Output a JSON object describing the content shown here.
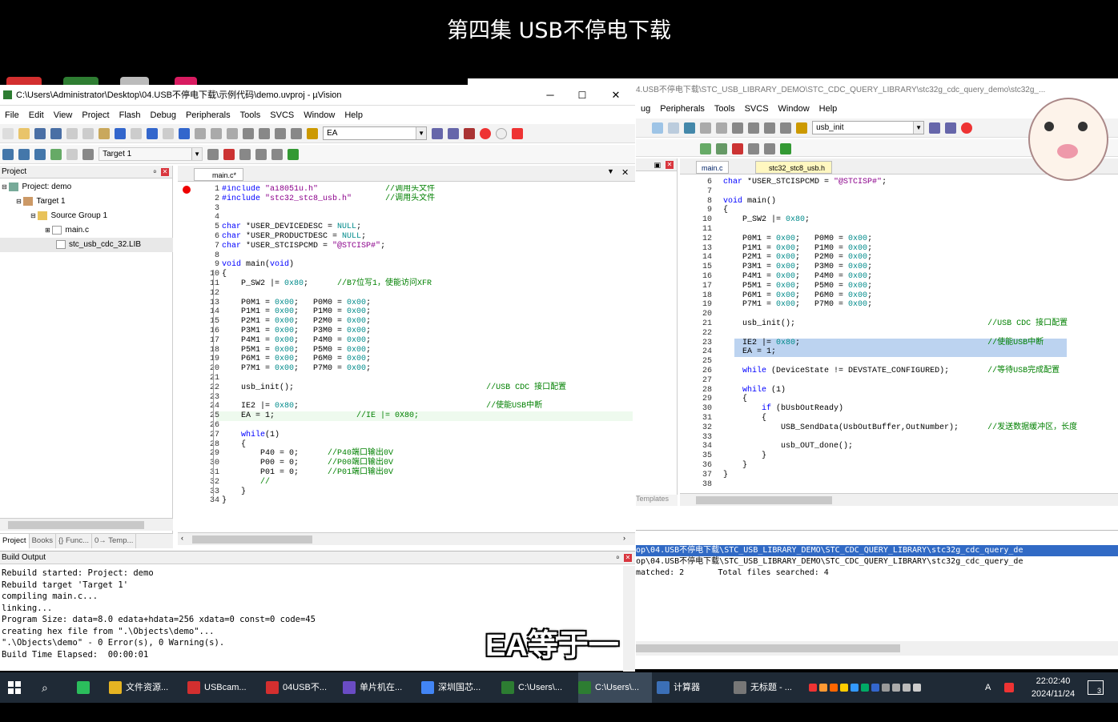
{
  "video_title": "第四集 USB不停电下载",
  "subtitle": "EA等于一",
  "left_window": {
    "title": "C:\\Users\\Administrator\\Desktop\\04.USB不停电下载\\示例代码\\demo.uvproj - µVision",
    "menu": [
      "File",
      "Edit",
      "View",
      "Project",
      "Flash",
      "Debug",
      "Peripherals",
      "Tools",
      "SVCS",
      "Window",
      "Help"
    ],
    "toolbar_combo": "EA",
    "target_combo": "Target 1",
    "project_pane_title": "Project",
    "tree": [
      "Project: demo",
      "Target 1",
      "Source Group 1",
      "main.c",
      "stc_usb_cdc_32.LIB"
    ],
    "bottom_tabs": [
      "Project",
      "Books",
      "{} Func...",
      "0→ Temp..."
    ],
    "editor_tab": "main.c*",
    "code_lines": [
      "#include \"ai8051u.h\"              //调用头文件",
      "#include \"stc32_stc8_usb.h\"       //调用头文件",
      "",
      "",
      "char *USER_DEVICEDESC = NULL;",
      "char *USER_PRODUCTDESC = NULL;",
      "char *USER_STCISPCMD = \"@STCISP#\";",
      "",
      "void main(void)",
      "{",
      "    P_SW2 |= 0x80;      //B7位写1，使能访问XFR",
      "",
      "    P0M1 = 0x00;   P0M0 = 0x00;",
      "    P1M1 = 0x00;   P1M0 = 0x00;",
      "    P2M1 = 0x00;   P2M0 = 0x00;",
      "    P3M1 = 0x00;   P3M0 = 0x00;",
      "    P4M1 = 0x00;   P4M0 = 0x00;",
      "    P5M1 = 0x00;   P5M0 = 0x00;",
      "    P6M1 = 0x00;   P6M0 = 0x00;",
      "    P7M1 = 0x00;   P7M0 = 0x00;",
      "",
      "    usb_init();                                        //USB CDC 接口配置",
      "",
      "    IE2 |= 0x80;                                       //使能USB中断",
      "    EA = 1;                 //IE |= 0X80;",
      "",
      "    while(1)",
      "    {",
      "        P40 = 0;      //P40端口输出0V",
      "        P00 = 0;      //P00端口输出0V",
      "        P01 = 0;      //P01端口输出0V",
      "        //",
      "    }",
      "}"
    ],
    "build_output_title": "Build Output",
    "build_output": [
      "Rebuild started: Project: demo",
      "Rebuild target 'Target 1'",
      "compiling main.c...",
      "linking...",
      "Program Size: data=8.0 edata+hdata=256 xdata=0 const=0 code=45",
      "creating hex file from \".\\Objects\\demo\"...",
      "\".\\Objects\\demo\" - 0 Error(s), 0 Warning(s).",
      "Build Time Elapsed:  00:00:01"
    ]
  },
  "right_window": {
    "title": "4.USB不停电下载\\STC_USB_LIBRARY_DEMO\\STC_CDC_QUERY_LIBRARY\\stc32g_cdc_query_demo\\stc32g_...",
    "menu": [
      "ug",
      "Peripherals",
      "Tools",
      "SVCS",
      "Window",
      "Help"
    ],
    "toolbar_combo": "usb_init",
    "tabs": [
      "main.c",
      "stc32_stc8_usb.h"
    ],
    "side_label": "Templates",
    "line_start": 6,
    "code_lines": [
      "char *USER_STCISPCMD = \"@STCISP#\";",
      "",
      "void main()",
      "{",
      "    P_SW2 |= 0x80;",
      "",
      "    P0M1 = 0x00;   P0M0 = 0x00;",
      "    P1M1 = 0x00;   P1M0 = 0x00;",
      "    P2M1 = 0x00;   P2M0 = 0x00;",
      "    P3M1 = 0x00;   P3M0 = 0x00;",
      "    P4M1 = 0x00;   P4M0 = 0x00;",
      "    P5M1 = 0x00;   P5M0 = 0x00;",
      "    P6M1 = 0x00;   P6M0 = 0x00;",
      "    P7M1 = 0x00;   P7M0 = 0x00;",
      "",
      "    usb_init();                                        //USB CDC 接口配置",
      "",
      "    IE2 |= 0x80;                                       //使能USB中断",
      "    EA = 1;",
      "",
      "    while (DeviceState != DEVSTATE_CONFIGURED);        //等待USB完成配置",
      "",
      "    while (1)",
      "    {",
      "        if (bUsbOutReady)",
      "        {",
      "            USB_SendData(UsbOutBuffer,OutNumber);      //发送数据缓冲区，长度",
      "",
      "            usb_OUT_done();",
      "        }",
      "    }",
      "}",
      ""
    ],
    "find_results": [
      "op\\04.USB不停电下载\\STC_USB_LIBRARY_DEMO\\STC_CDC_QUERY_LIBRARY\\stc32g_cdc_query_de",
      "op\\04.USB不停电下载\\STC_USB_LIBRARY_DEMO\\STC_CDC_QUERY_LIBRARY\\stc32g_cdc_query_de",
      "matched: 2       Total files searched: 4"
    ]
  },
  "taskbar": {
    "items": [
      "文件资源...",
      "USBcam...",
      "04USB不...",
      "单片机在...",
      "深圳国芯...",
      "C:\\Users\\...",
      "C:\\Users\\...",
      "计算器",
      "无标题 - ..."
    ],
    "tray_lang": "A",
    "time": "22:02:40",
    "date": "2024/11/24",
    "notif_count": "3"
  }
}
